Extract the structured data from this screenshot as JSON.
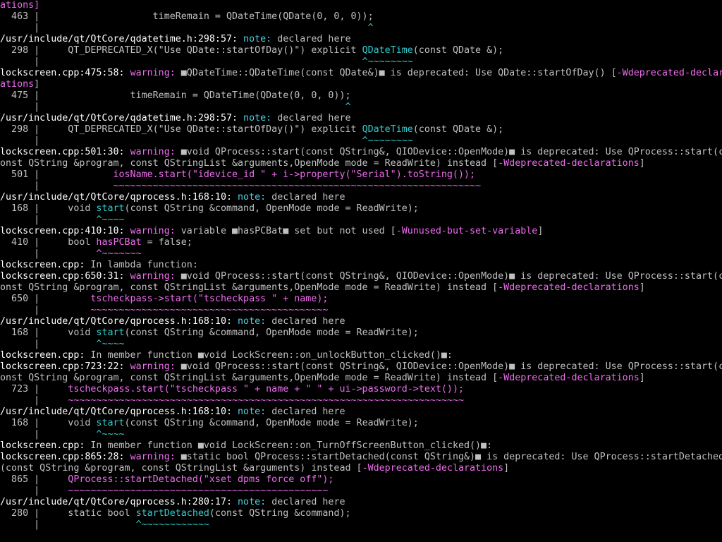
{
  "lines": [
    [
      [
        "w",
        "ations]"
      ]
    ],
    [
      [
        "d",
        "  463 |                    timeRemain = QDateTime(QDate(0, 0, 0));"
      ]
    ],
    [
      [
        "d",
        "      |                                                          "
      ],
      [
        "c",
        "^"
      ]
    ],
    [
      [
        "k",
        "/usr/include/qt/QtCore/qdatetime.h:298:57: "
      ],
      [
        "n",
        "note: "
      ],
      [
        "d",
        "declared here"
      ]
    ],
    [
      [
        "d",
        "  298 |     QT_DEPRECATED_X(\"Use QDate::startOfDay()\") explicit "
      ],
      [
        "c",
        "QDateTime"
      ],
      [
        "d",
        "(const QDate &);"
      ]
    ],
    [
      [
        "d",
        "      |                                                         "
      ],
      [
        "c",
        "^~~~~~~~~"
      ]
    ],
    [
      [
        "k",
        "lockscreen.cpp:475:58: "
      ],
      [
        "w",
        "warning: "
      ],
      [
        "d",
        "■QDateTime::QDateTime(const QDate&)■ is deprecated: Use QDate::startOfDay() ["
      ],
      [
        "w",
        "-Wdeprecated-declar"
      ]
    ],
    [
      [
        "w",
        "ations"
      ],
      [
        "d",
        "]"
      ]
    ],
    [
      [
        "d",
        "  475 |                timeRemain = QDateTime(QDate(0, 0, 0));"
      ]
    ],
    [
      [
        "d",
        "      |                                                      "
      ],
      [
        "c",
        "^"
      ]
    ],
    [
      [
        "k",
        "/usr/include/qt/QtCore/qdatetime.h:298:57: "
      ],
      [
        "n",
        "note: "
      ],
      [
        "d",
        "declared here"
      ]
    ],
    [
      [
        "d",
        "  298 |     QT_DEPRECATED_X(\"Use QDate::startOfDay()\") explicit "
      ],
      [
        "c",
        "QDateTime"
      ],
      [
        "d",
        "(const QDate &);"
      ]
    ],
    [
      [
        "d",
        "      |                                                         "
      ],
      [
        "c",
        "^~~~~~~~~"
      ]
    ],
    [
      [
        "k",
        "lockscreen.cpp:501:30: "
      ],
      [
        "w",
        "warning: "
      ],
      [
        "d",
        "■void QProcess::start(const QString&, QIODevice::OpenMode)■ is deprecated: Use QProcess::start(c"
      ]
    ],
    [
      [
        "d",
        "onst QString &program, const QStringList &arguments,OpenMode mode = ReadWrite) instead ["
      ],
      [
        "w",
        "-Wdeprecated-declarations"
      ],
      [
        "d",
        "]"
      ]
    ],
    [
      [
        "d",
        "  501 |             "
      ],
      [
        "m",
        "iosName.start(\"idevice_id \" + i->property(\"Serial\").toString());"
      ]
    ],
    [
      [
        "d",
        "      |             "
      ],
      [
        "m",
        "~~~~~~~~~~~~~~~~~~~~~~~~~~~~~~~~~~~~~~~~~~~~~~~~~~~~~~~~~~~~~~~~~"
      ]
    ],
    [
      [
        "k",
        "/usr/include/qt/QtCore/qprocess.h:168:10: "
      ],
      [
        "n",
        "note: "
      ],
      [
        "d",
        "declared here"
      ]
    ],
    [
      [
        "d",
        "  168 |     void "
      ],
      [
        "c",
        "start"
      ],
      [
        "d",
        "(const QString &command, OpenMode mode = ReadWrite);"
      ]
    ],
    [
      [
        "d",
        "      |          "
      ],
      [
        "c",
        "^~~~~"
      ]
    ],
    [
      [
        "k",
        "lockscreen.cpp:410:10: "
      ],
      [
        "w",
        "warning: "
      ],
      [
        "d",
        "variable ■hasPCBat■ set but not used ["
      ],
      [
        "w",
        "-Wunused-but-set-variable"
      ],
      [
        "d",
        "]"
      ]
    ],
    [
      [
        "d",
        "  410 |     bool "
      ],
      [
        "m",
        "hasPCBat"
      ],
      [
        "d",
        " = false;"
      ]
    ],
    [
      [
        "d",
        "      |          "
      ],
      [
        "m",
        "^~~~~~~~"
      ]
    ],
    [
      [
        "k",
        "lockscreen.cpp: "
      ],
      [
        "d",
        "In lambda function:"
      ]
    ],
    [
      [
        "k",
        "lockscreen.cpp:650:31: "
      ],
      [
        "w",
        "warning: "
      ],
      [
        "d",
        "■void QProcess::start(const QString&, QIODevice::OpenMode)■ is deprecated: Use QProcess::start(c"
      ]
    ],
    [
      [
        "d",
        "onst QString &program, const QStringList &arguments,OpenMode mode = ReadWrite) instead ["
      ],
      [
        "w",
        "-Wdeprecated-declarations"
      ],
      [
        "d",
        "]"
      ]
    ],
    [
      [
        "d",
        "  650 |         "
      ],
      [
        "m",
        "tscheckpass->start(\"tscheckpass \" + name);"
      ]
    ],
    [
      [
        "d",
        "      |         "
      ],
      [
        "m",
        "~~~~~~~~~~~~~~~~~~~~~~~~~~~~~~~~~~~~~~~~~~"
      ]
    ],
    [
      [
        "k",
        "/usr/include/qt/QtCore/qprocess.h:168:10: "
      ],
      [
        "n",
        "note: "
      ],
      [
        "d",
        "declared here"
      ]
    ],
    [
      [
        "d",
        "  168 |     void "
      ],
      [
        "c",
        "start"
      ],
      [
        "d",
        "(const QString &command, OpenMode mode = ReadWrite);"
      ]
    ],
    [
      [
        "d",
        "      |          "
      ],
      [
        "c",
        "^~~~~"
      ]
    ],
    [
      [
        "k",
        "lockscreen.cpp: "
      ],
      [
        "d",
        "In member function ■void LockScreen::on_unlockButton_clicked()■:"
      ]
    ],
    [
      [
        "k",
        "lockscreen.cpp:723:22: "
      ],
      [
        "w",
        "warning: "
      ],
      [
        "d",
        "■void QProcess::start(const QString&, QIODevice::OpenMode)■ is deprecated: Use QProcess::start(c"
      ]
    ],
    [
      [
        "d",
        "onst QString &program, const QStringList &arguments,OpenMode mode = ReadWrite) instead ["
      ],
      [
        "w",
        "-Wdeprecated-declarations"
      ],
      [
        "d",
        "]"
      ]
    ],
    [
      [
        "d",
        "  723 |     "
      ],
      [
        "m",
        "tscheckpass.start(\"tscheckpass \" + name + \" \" + ui->password->text());"
      ]
    ],
    [
      [
        "d",
        "      |     "
      ],
      [
        "m",
        "~~~~~~~~~~~~~~~~~~~~~~~~~~~~~~~~~~~~~~~~~~~~~~~~~~~~~~~~~~~~~~~~~~~~~~"
      ]
    ],
    [
      [
        "k",
        "/usr/include/qt/QtCore/qprocess.h:168:10: "
      ],
      [
        "n",
        "note: "
      ],
      [
        "d",
        "declared here"
      ]
    ],
    [
      [
        "d",
        "  168 |     void "
      ],
      [
        "c",
        "start"
      ],
      [
        "d",
        "(const QString &command, OpenMode mode = ReadWrite);"
      ]
    ],
    [
      [
        "d",
        "      |          "
      ],
      [
        "c",
        "^~~~~"
      ]
    ],
    [
      [
        "k",
        "lockscreen.cpp: "
      ],
      [
        "d",
        "In member function ■void LockScreen::on_TurnOffScreenButton_clicked()■:"
      ]
    ],
    [
      [
        "k",
        "lockscreen.cpp:865:28: "
      ],
      [
        "w",
        "warning: "
      ],
      [
        "d",
        "■static bool QProcess::startDetached(const QString&)■ is deprecated: Use QProcess::startDetached"
      ]
    ],
    [
      [
        "d",
        "(const QString &program, const QStringList &arguments) instead ["
      ],
      [
        "w",
        "-Wdeprecated-declarations"
      ],
      [
        "d",
        "]"
      ]
    ],
    [
      [
        "d",
        "  865 |     "
      ],
      [
        "m",
        "QProcess::startDetached(\"xset dpms force off\");"
      ]
    ],
    [
      [
        "d",
        "      |     "
      ],
      [
        "m",
        "~~~~~~~~~~~~~~~~~~~~~~~~~~~~~~~~~~~~~~~~~~~~~~"
      ]
    ],
    [
      [
        "k",
        "/usr/include/qt/QtCore/qprocess.h:280:17: "
      ],
      [
        "n",
        "note: "
      ],
      [
        "d",
        "declared here"
      ]
    ],
    [
      [
        "d",
        "  280 |     static bool "
      ],
      [
        "c",
        "startDetached"
      ],
      [
        "d",
        "(const QString &command);"
      ]
    ],
    [
      [
        "d",
        "      |                 "
      ],
      [
        "c",
        "^~~~~~~~~~~~~"
      ]
    ]
  ]
}
